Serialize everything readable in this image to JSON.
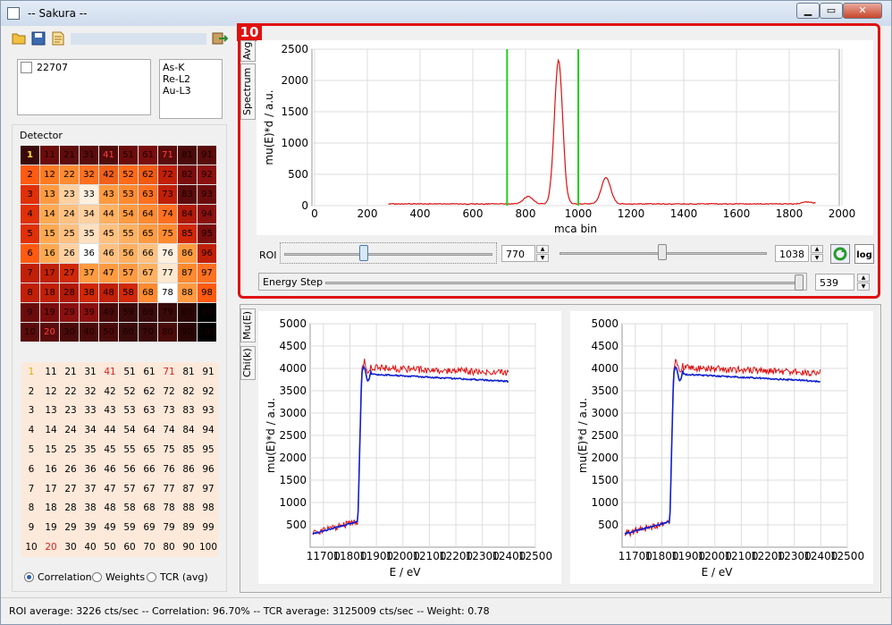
{
  "window": {
    "title": "-- Sakura --",
    "min": "▁",
    "max": "▭",
    "close": "✕"
  },
  "toolbar": {
    "icons": [
      "open-icon",
      "save-icon",
      "report-icon",
      "exit-icon"
    ]
  },
  "samples": [
    {
      "label": "22707",
      "checked": false
    }
  ],
  "edges": [
    "As-K",
    "Re-L2",
    "Au-L3"
  ],
  "detector": {
    "title": "Detector",
    "cells": [
      [
        "1",
        "11",
        "21",
        "31",
        "41",
        "51",
        "61",
        "71",
        "81",
        "91"
      ],
      [
        "2",
        "12",
        "22",
        "32",
        "42",
        "52",
        "62",
        "72",
        "82",
        "92"
      ],
      [
        "3",
        "13",
        "23",
        "33",
        "43",
        "53",
        "63",
        "73",
        "83",
        "93"
      ],
      [
        "4",
        "14",
        "24",
        "34",
        "44",
        "54",
        "64",
        "74",
        "84",
        "94"
      ],
      [
        "5",
        "15",
        "25",
        "35",
        "45",
        "55",
        "65",
        "75",
        "85",
        "95"
      ],
      [
        "6",
        "16",
        "26",
        "36",
        "46",
        "56",
        "66",
        "76",
        "86",
        "96"
      ],
      [
        "7",
        "17",
        "27",
        "37",
        "47",
        "57",
        "67",
        "77",
        "87",
        "97"
      ],
      [
        "8",
        "18",
        "28",
        "38",
        "48",
        "58",
        "68",
        "78",
        "88",
        "98"
      ],
      [
        "9",
        "19",
        "29",
        "39",
        "49",
        "59",
        "69",
        "79",
        "89",
        "99"
      ],
      [
        "10",
        "20",
        "30",
        "40",
        "50",
        "60",
        "70",
        "80",
        "90",
        "100"
      ]
    ],
    "colors": [
      [
        "#3a0a0a",
        "#6b0c0c",
        "#5e0c0c",
        "#5a0b0b",
        "#520b0b",
        "#6b0c0c",
        "#7a0d0d",
        "#5a0b0b",
        "#4a0a0a",
        "#5a0b0b"
      ],
      [
        "#ff5a10",
        "#ff7a20",
        "#ff8a30",
        "#ff7020",
        "#f06018",
        "#ff6a18",
        "#f05a10",
        "#c02008",
        "#7a0d0d",
        "#8a1010"
      ],
      [
        "#e03008",
        "#ff9a40",
        "#ffd0a0",
        "#fff0e0",
        "#ff9a40",
        "#ff8a30",
        "#ff7020",
        "#c02008",
        "#5a0b0b",
        "#6b0c0c"
      ],
      [
        "#e03008",
        "#ffa850",
        "#ffc080",
        "#ffd0a0",
        "#ffb060",
        "#ff9a40",
        "#ff8a30",
        "#ff7020",
        "#b01a08",
        "#8a1010"
      ],
      [
        "#e03008",
        "#ffa850",
        "#ffc080",
        "#ffe0c0",
        "#ffc080",
        "#ffb060",
        "#ff9a40",
        "#ff8a30",
        "#d02808",
        "#7a0d0d"
      ],
      [
        "#ff5a10",
        "#ffa850",
        "#ffd0a0",
        "#ffffff",
        "#ffc080",
        "#ffb060",
        "#ffc080",
        "#fff0e0",
        "#ff9a40",
        "#c02008"
      ],
      [
        "#c02008",
        "#c02008",
        "#d02808",
        "#ff9a40",
        "#ff9a40",
        "#ff9a40",
        "#ffb060",
        "#ffe8d0",
        "#ff8a30",
        "#ff7020"
      ],
      [
        "#c02008",
        "#c02008",
        "#b01a08",
        "#d02808",
        "#c02008",
        "#d02808",
        "#ff8a30",
        "#ffffff",
        "#ff9a40",
        "#ff5a10"
      ],
      [
        "#6b0c0c",
        "#7a0d0d",
        "#8a1010",
        "#8a1010",
        "#4a0a0a",
        "#3a0a0a",
        "#3a0a0a",
        "#3a0a0a",
        "#2a0505",
        "#000000"
      ],
      [
        "#5a0b0b",
        "#5a0b0b",
        "#4a0a0a",
        "#4a0a0a",
        "#4a0a0a",
        "#3a0a0a",
        "#3a0a0a",
        "#4a0a0a",
        "#2a0505",
        "#000000"
      ]
    ],
    "highlight": {
      "1": "#ffe030",
      "41": "#ff4040",
      "71": "#ff4040",
      "20": "#ff4040"
    }
  },
  "weights": {
    "radios": [
      {
        "label": "Correlation",
        "on": true
      },
      {
        "label": "Weights",
        "on": false
      },
      {
        "label": "TCR (avg)",
        "on": false
      }
    ]
  },
  "badge": "10",
  "tabs_top": [
    "Avg",
    "Spectrum"
  ],
  "tabs_bottom": [
    "Mu(E)",
    "Chi(k)"
  ],
  "spectrum": {
    "ylabel": "mu(E)*d  /  a.u.",
    "xlabel": "mca bin",
    "yticks": [
      "2500",
      "2000",
      "1500",
      "1000",
      "500",
      "0"
    ],
    "xticks": [
      "0",
      "200",
      "400",
      "600",
      "800",
      "1000",
      "1200",
      "1400",
      "1600",
      "1800",
      "2000"
    ],
    "roi_lines": [
      730,
      1000
    ]
  },
  "roi": {
    "label": "ROI",
    "low": "770",
    "high": "1038"
  },
  "energy": {
    "label": "Energy Step",
    "value": "539"
  },
  "mu_plots": [
    {
      "ylabel": "mu(E)*d  /  a.u.",
      "xlabel": "E  /  eV",
      "yticks": [
        "5000",
        "4500",
        "4000",
        "3500",
        "3000",
        "2500",
        "2000",
        "1500",
        "1000",
        "500"
      ],
      "xticks": [
        "11700",
        "11800",
        "11900",
        "12000",
        "12100",
        "12200",
        "12300",
        "12400",
        "12500"
      ]
    },
    {
      "ylabel": "mu(E)*d  /  a.u.",
      "xlabel": "E  /  eV",
      "yticks": [
        "5000",
        "4500",
        "4000",
        "3500",
        "3000",
        "2500",
        "2000",
        "1500",
        "1000",
        "500"
      ],
      "xticks": [
        "11700",
        "11800",
        "11900",
        "12000",
        "12100",
        "12200",
        "12300",
        "12400",
        "12500"
      ]
    }
  ],
  "status": "ROI average: 3226 cts/sec  --  Correlation: 96.70%  --  TCR average: 3125009 cts/sec  --  Weight: 0.78"
}
